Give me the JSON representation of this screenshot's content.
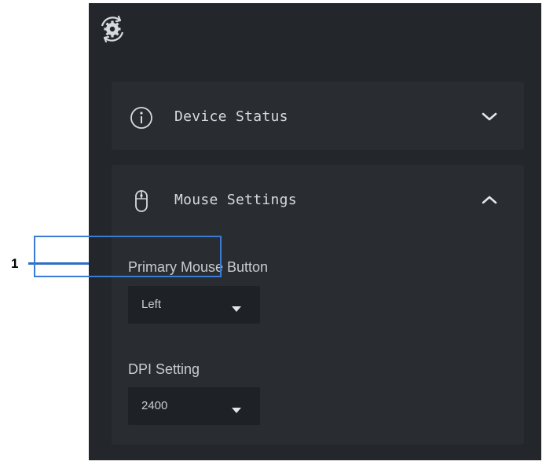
{
  "callout": {
    "number": "1",
    "color": "#2e6fc4"
  },
  "app": {
    "logo_icon": "gear-sync-icon",
    "background": "#23262b"
  },
  "sections": {
    "device_status": {
      "title": "Device Status",
      "icon": "info-circle-icon",
      "chevron": "chevron-down-icon",
      "expanded": false
    },
    "mouse_settings": {
      "title": "Mouse Settings",
      "icon": "mouse-icon",
      "chevron": "chevron-up-icon",
      "expanded": true,
      "primary_button": {
        "label": "Primary Mouse Button",
        "value": "Left"
      },
      "dpi": {
        "label": "DPI Setting",
        "value": "2400"
      }
    }
  },
  "highlight_color": "#3a7bd5"
}
